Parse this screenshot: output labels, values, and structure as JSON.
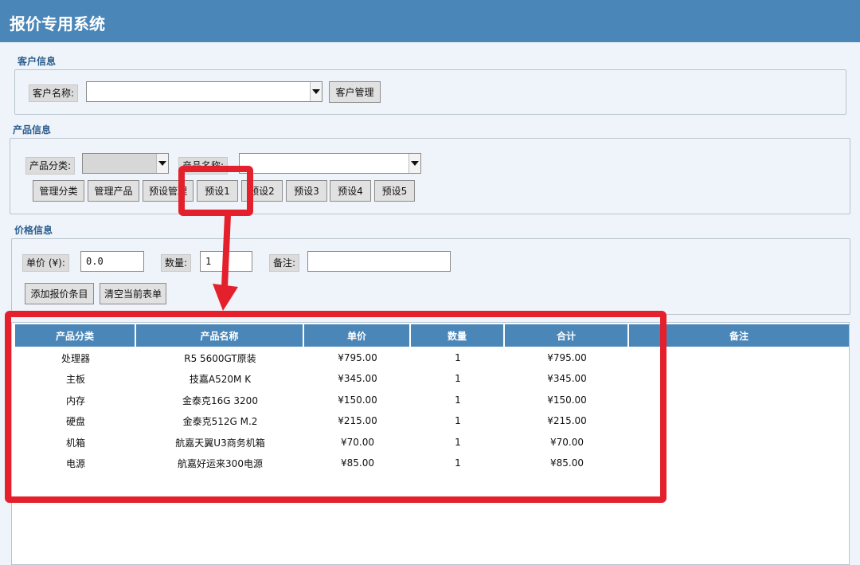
{
  "app": {
    "title": "报价专用系统"
  },
  "customer": {
    "section_title": "客户信息",
    "name_label": "客户名称:",
    "name_value": "",
    "manage_button": "客户管理"
  },
  "product": {
    "section_title": "产品信息",
    "category_label": "产品分类:",
    "category_value": "",
    "name_label": "产品名称:",
    "name_value": "",
    "buttons": [
      "管理分类",
      "管理产品",
      "预设管理",
      "预设1",
      "预设2",
      "预设3",
      "预设4",
      "预设5"
    ]
  },
  "price": {
    "section_title": "价格信息",
    "unit_price_label": "单价 (¥):",
    "unit_price_value": "0.0",
    "quantity_label": "数量:",
    "quantity_value": "1",
    "note_label": "备注:",
    "note_value": "",
    "add_button": "添加报价条目",
    "clear_button": "清空当前表单"
  },
  "table": {
    "columns": [
      "产品分类",
      "产品名称",
      "单价",
      "数量",
      "合计",
      "备注"
    ],
    "rows": [
      [
        "处理器",
        "R5 5600GT原装",
        "¥795.00",
        "1",
        "¥795.00",
        ""
      ],
      [
        "主板",
        "技嘉A520M K",
        "¥345.00",
        "1",
        "¥345.00",
        ""
      ],
      [
        "内存",
        "金泰克16G 3200",
        "¥150.00",
        "1",
        "¥150.00",
        ""
      ],
      [
        "硬盘",
        "金泰克512G M.2",
        "¥215.00",
        "1",
        "¥215.00",
        ""
      ],
      [
        "机箱",
        "航嘉天翼U3商务机箱",
        "¥70.00",
        "1",
        "¥70.00",
        ""
      ],
      [
        "电源",
        "航嘉好运来300电源",
        "¥85.00",
        "1",
        "¥85.00",
        ""
      ]
    ]
  },
  "colors": {
    "accent": "#4a87b8",
    "annotation": "#e3202b",
    "background": "#eef4fa"
  }
}
